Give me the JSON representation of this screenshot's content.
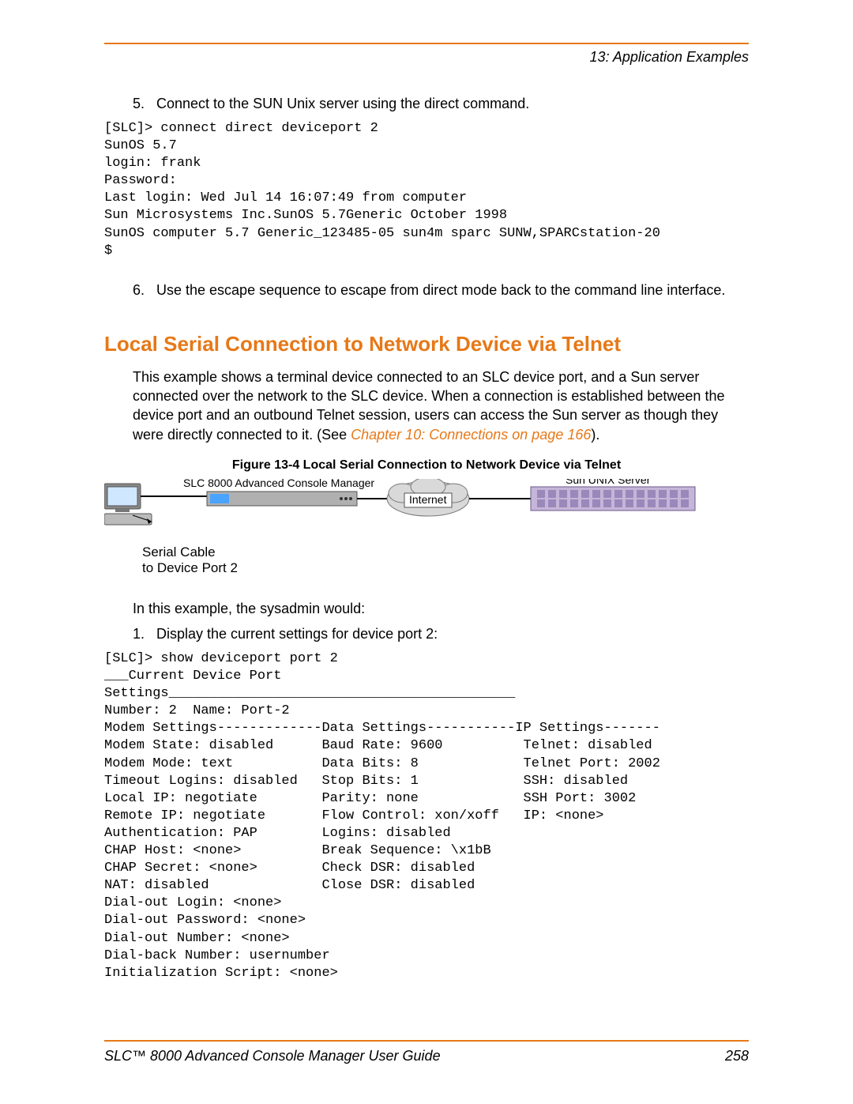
{
  "header": {
    "chapter_label": "13: Application Examples"
  },
  "steps_a": [
    {
      "n": "5.",
      "text": "Connect to the SUN Unix server using the direct command."
    }
  ],
  "code1": "[SLC]> connect direct deviceport 2\nSunOS 5.7\nlogin: frank\nPassword:\nLast login: Wed Jul 14 16:07:49 from computer\nSun Microsystems Inc.SunOS 5.7Generic October 1998\nSunOS computer 5.7 Generic_123485-05 sun4m sparc SUNW,SPARCstation-20\n$",
  "steps_b": [
    {
      "n": "6.",
      "text": "Use the escape sequence to escape from direct mode back to the command line interface."
    }
  ],
  "heading": "Local Serial Connection to Network Device via Telnet",
  "intro_plain": "This example shows a terminal device connected to an SLC device port, and a Sun server connected over the network to the SLC device. When a connection is established between the device port and an outbound Telnet session, users can access the Sun server as though they were directly connected to it. (See ",
  "intro_link": "Chapter 10: Connections on page 166",
  "intro_tail": ").",
  "figure": {
    "caption": "Figure 13-4  Local Serial Connection to Network Device via Telnet",
    "label_console": "SLC 8000 Advanced Console Manager",
    "label_internet": "Internet",
    "label_server": "Sun UNIX Server",
    "sub1": "Serial Cable",
    "sub2": "to Device Port 2"
  },
  "para2": "In this example, the sysadmin would:",
  "steps_c": [
    {
      "n": "1.",
      "text": "Display the current settings for device port 2:"
    }
  ],
  "code2": "[SLC]> show deviceport port 2\n___Current Device Port \nSettings___________________________________________\nNumber: 2  Name: Port-2\nModem Settings-------------Data Settings-----------IP Settings-------\nModem State: disabled      Baud Rate: 9600          Telnet: disabled\nModem Mode: text           Data Bits: 8             Telnet Port: 2002\nTimeout Logins: disabled   Stop Bits: 1             SSH: disabled\nLocal IP: negotiate        Parity: none             SSH Port: 3002\nRemote IP: negotiate       Flow Control: xon/xoff   IP: <none>\nAuthentication: PAP        Logins: disabled\nCHAP Host: <none>          Break Sequence: \\x1bB\nCHAP Secret: <none>        Check DSR: disabled\nNAT: disabled              Close DSR: disabled\nDial-out Login: <none>\nDial-out Password: <none>\nDial-out Number: <none>\nDial-back Number: usernumber\nInitialization Script: <none>",
  "footer": {
    "title": "SLC™ 8000 Advanced Console Manager User Guide",
    "page": "258"
  }
}
